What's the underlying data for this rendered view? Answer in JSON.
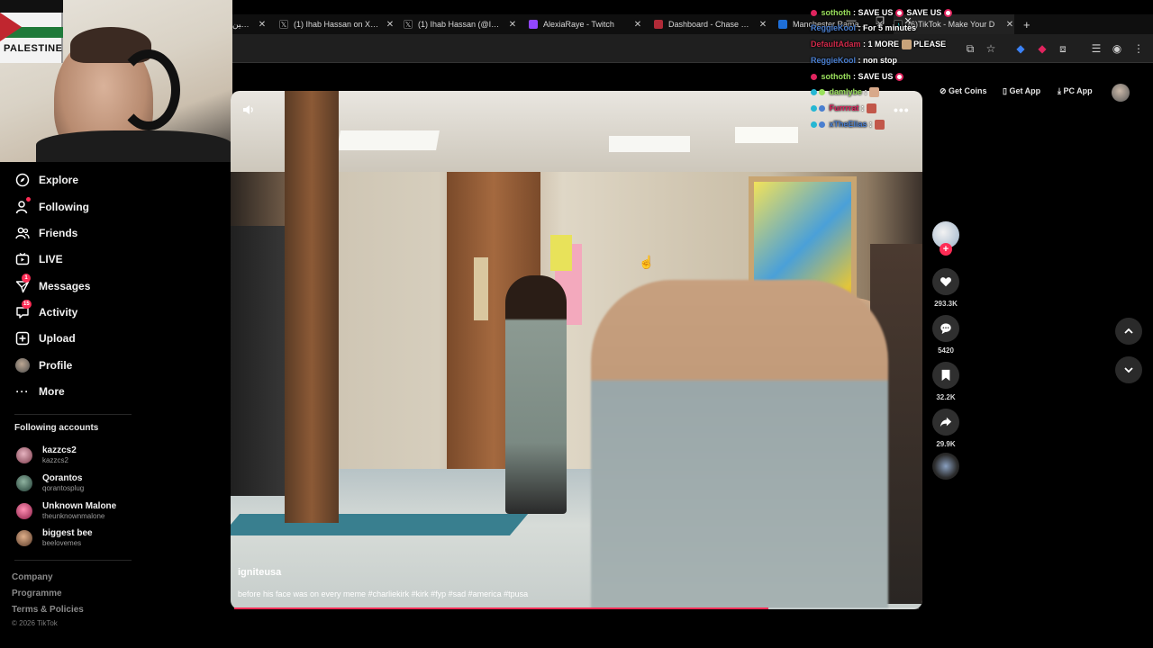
{
  "browser": {
    "tabs": [
      {
        "label": "قناة فلسطين",
        "icon": "generic-tab-icon",
        "color": "#444444"
      },
      {
        "label": "(1) Ihab Hassan on X: \"BR",
        "icon": "x-logo-icon",
        "color": "#000000"
      },
      {
        "label": "(1) Ihab Hassan (@IhabHa",
        "icon": "x-logo-icon",
        "color": "#000000"
      },
      {
        "label": "AlexiaRaye - Twitch",
        "icon": "twitch-icon",
        "color": "#9146ff"
      },
      {
        "label": "Dashboard - Chase Rolep",
        "icon": "dashboard-icon",
        "color": "#b02a37"
      },
      {
        "label": "Manchester Ramadan T",
        "icon": "site-icon",
        "color": "#1e6fd9"
      },
      {
        "label": "(6)TikTok - Make Your D",
        "icon": "tiktok-icon",
        "color": "#111111"
      }
    ],
    "new_tab": "+",
    "window_controls": {
      "minimize": "—",
      "maximize": "❐",
      "close": "✕"
    }
  },
  "webcam": {
    "poster_text": "PALESTINE"
  },
  "sidebar": {
    "nav": [
      {
        "label": "Explore",
        "icon": "compass-icon"
      },
      {
        "label": "Following",
        "icon": "following-icon",
        "dot": true
      },
      {
        "label": "Friends",
        "icon": "friends-icon"
      },
      {
        "label": "LIVE",
        "icon": "live-icon"
      },
      {
        "label": "Messages",
        "icon": "messages-icon",
        "badge": "1"
      },
      {
        "label": "Activity",
        "icon": "activity-icon",
        "badge": "15"
      },
      {
        "label": "Upload",
        "icon": "upload-icon"
      },
      {
        "label": "Profile",
        "icon": "profile-avatar-icon"
      },
      {
        "label": "More",
        "icon": "more-icon"
      }
    ],
    "following_heading": "Following accounts",
    "accounts": [
      {
        "name": "kazzcs2",
        "handle": "kazzcs2",
        "color": "#b76a7a"
      },
      {
        "name": "Qorantos",
        "handle": "qorantosplug",
        "color": "#3a6a5a"
      },
      {
        "name": "Unknown Malone",
        "handle": "theunknownmalone",
        "color": "#c04070"
      },
      {
        "name": "biggest bee",
        "handle": "beelovemes",
        "color": "#a07050"
      }
    ],
    "footer": [
      "Company",
      "Programme",
      "Terms & Policies"
    ],
    "copyright": "© 2026 TikTok"
  },
  "header": {
    "get_coins": "Get Coins",
    "get_app": "Get App",
    "pc_app": "PC App"
  },
  "video": {
    "author": "igniteusa",
    "caption": "before his face was on every meme #charliekirk #kirk #fyp #sad #america #tpusa",
    "progress": 0.78,
    "more": "•••"
  },
  "actions": {
    "likes": "293.3K",
    "comments": "5420",
    "saves": "32.2K",
    "shares": "29.9K"
  },
  "chat": [
    {
      "user": "sothoth",
      "user_color": "#9be15d",
      "msg": "SAVE US",
      "rec": true,
      "extra": "SAVE US",
      "rec2": true
    },
    {
      "user": "ReggieKool",
      "user_color": "#4a7fd0",
      "msg": "For 5 minutes"
    },
    {
      "user": "DefaultAdam",
      "user_color": "#d02a4a",
      "msg": "1 MORE",
      "extra": "PLEASE"
    },
    {
      "user": "ReggieKool",
      "user_color": "#4a7fd0",
      "msg": "non stop"
    },
    {
      "user": "sothoth",
      "user_color": "#9be15d",
      "msg": "SAVE US",
      "rec": true
    },
    {
      "user": "damlybe",
      "user_color": "#9be15d",
      "msg": ""
    },
    {
      "user": "Furrrrat",
      "user_color": "#e0245e",
      "msg": ""
    },
    {
      "user": "xTheElias",
      "user_color": "#4a7fd0",
      "msg": ""
    }
  ]
}
